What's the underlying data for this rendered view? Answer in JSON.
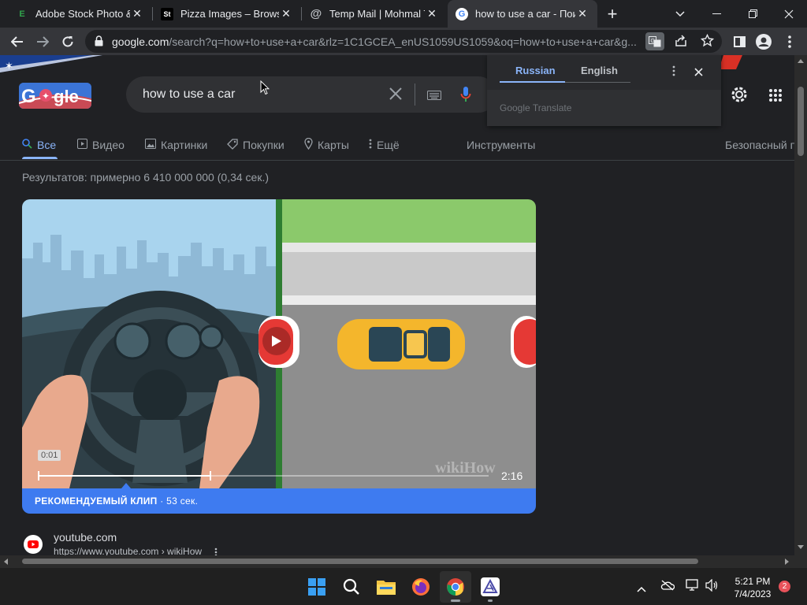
{
  "browser": {
    "tabs": [
      {
        "title": "Adobe Stock Photo & V",
        "favicon_text": "E"
      },
      {
        "title": "Pizza Images – Browse",
        "favicon_text": "St"
      },
      {
        "title": "Temp Mail | Mohmal Te",
        "favicon_text": "@"
      },
      {
        "title": "how to use a car - Пои",
        "favicon_text": "G"
      }
    ],
    "url_host": "google.com",
    "url_rest": "/search?q=how+to+use+a+car&rlz=1C1GCEA_enUS1059US1059&oq=how+to+use+a+car&g..."
  },
  "translate": {
    "lang_from": "Russian",
    "lang_to": "English",
    "brand": "Google Translate"
  },
  "search": {
    "query": "how to use a car",
    "nav": [
      {
        "label": "Все",
        "icon": "search-icon"
      },
      {
        "label": "Видео",
        "icon": "video-icon"
      },
      {
        "label": "Картинки",
        "icon": "image-icon"
      },
      {
        "label": "Покупки",
        "icon": "tag-icon"
      },
      {
        "label": "Карты",
        "icon": "map-pin-icon"
      },
      {
        "label": "Ещё",
        "icon": "more-vert-icon"
      }
    ],
    "tools": "Инструменты",
    "safesearch": "Безопасный п",
    "stats": "Результатов: примерно 6 410 000 000 (0,34 сек.)"
  },
  "video": {
    "current_time": "0:01",
    "duration": "2:16",
    "watermark": "wikiHow",
    "progress": 0.38
  },
  "featured": {
    "label": "РЕКОМЕНДУЕМЫЙ КЛИП",
    "duration": " · 53 сек."
  },
  "result": {
    "site": "youtube.com",
    "url": "https://www.youtube.com › wikiHow"
  },
  "taskbar": {
    "time": "5:21 PM",
    "date": "7/4/2023",
    "notifications": "2"
  }
}
